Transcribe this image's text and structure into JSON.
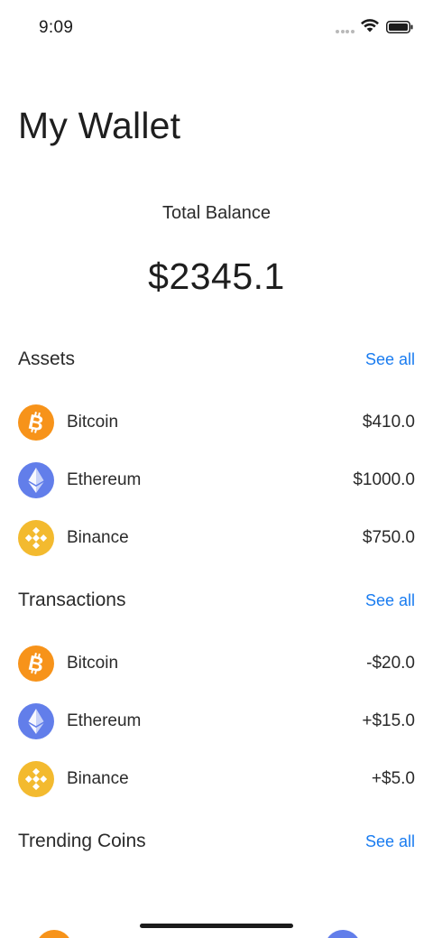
{
  "status_bar": {
    "time": "9:09"
  },
  "title": "My Wallet",
  "balance": {
    "label": "Total Balance",
    "value": "$2345.1"
  },
  "colors": {
    "bitcoin": "#f7931a",
    "ethereum": "#627eea",
    "binance": "#f3ba2f",
    "link": "#1a7cf0"
  },
  "assets": {
    "title": "Assets",
    "see_all": "See all",
    "items": [
      {
        "name": "Bitcoin",
        "amount": "$410.0",
        "icon": "bitcoin-icon"
      },
      {
        "name": "Ethereum",
        "amount": "$1000.0",
        "icon": "ethereum-icon"
      },
      {
        "name": "Binance",
        "amount": "$750.0",
        "icon": "binance-icon"
      }
    ]
  },
  "transactions": {
    "title": "Transactions",
    "see_all": "See all",
    "items": [
      {
        "name": "Bitcoin",
        "amount": "-$20.0",
        "icon": "bitcoin-icon"
      },
      {
        "name": "Ethereum",
        "amount": "+$15.0",
        "icon": "ethereum-icon"
      },
      {
        "name": "Binance",
        "amount": "+$5.0",
        "icon": "binance-icon"
      }
    ]
  },
  "trending": {
    "title": "Trending Coins",
    "see_all": "See all"
  }
}
